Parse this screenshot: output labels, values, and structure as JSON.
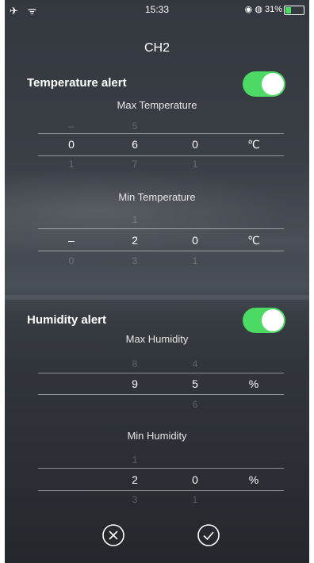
{
  "status": {
    "left_icons": "✈ ᯤ",
    "time": "15:33",
    "right": "◉ ◍ 31%",
    "battery_level": 0.31
  },
  "title": "CH2",
  "temperature": {
    "label": "Temperature alert",
    "enabled": true,
    "max": {
      "title": "Max Temperature",
      "above": [
        "–",
        "5",
        ""
      ],
      "selected": [
        "0",
        "6",
        "0"
      ],
      "below": [
        "1",
        "7",
        "1"
      ],
      "unit": "℃"
    },
    "min": {
      "title": "Min Temperature",
      "above": [
        "",
        "1",
        ""
      ],
      "selected": [
        "–",
        "2",
        "0"
      ],
      "below": [
        "0",
        "3",
        "1"
      ],
      "unit": "℃"
    }
  },
  "humidity": {
    "label": "Humidity alert",
    "enabled": true,
    "max": {
      "title": "Max Humidity",
      "above": [
        "8",
        "4"
      ],
      "selected": [
        "9",
        "5"
      ],
      "below": [
        "",
        "6"
      ],
      "unit": "%"
    },
    "min": {
      "title": "Min Humidity",
      "above": [
        "1",
        ""
      ],
      "selected": [
        "2",
        "0"
      ],
      "below": [
        "3",
        "1"
      ],
      "unit": "%"
    }
  },
  "actions": {
    "cancel_icon": "circle-x-icon",
    "confirm_icon": "circle-check-icon"
  }
}
